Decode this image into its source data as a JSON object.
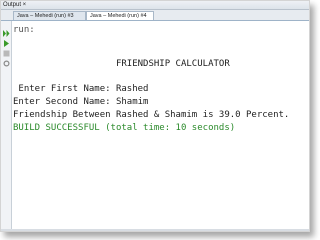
{
  "window": {
    "title": "Output ×"
  },
  "tabs": [
    {
      "label": "Java – Mehedi (run) #3",
      "active": false
    },
    {
      "label": "Java – Mehedi (run) #4",
      "active": true
    }
  ],
  "toolbar": {
    "icons": [
      "run-again-icon",
      "rerun-icon",
      "stop-icon",
      "settings-icon"
    ]
  },
  "console": {
    "lines": [
      {
        "text": "run:",
        "kind": "run"
      },
      {
        "text": "                   FRIENDSHIP CALCULATOR",
        "kind": "normal"
      },
      {
        "text": " Enter First Name: Rashed",
        "kind": "normal"
      },
      {
        "text": "Enter Second Name: Shamim",
        "kind": "normal"
      },
      {
        "text": "Friendship Between Rashed & Shamim is 39.0 Percent.",
        "kind": "normal"
      },
      {
        "text": "BUILD SUCCESSFUL (total time: 10 seconds)",
        "kind": "success"
      }
    ]
  },
  "colors": {
    "success": "#2b8a2b",
    "run_arrow": "#3a9a2a"
  }
}
